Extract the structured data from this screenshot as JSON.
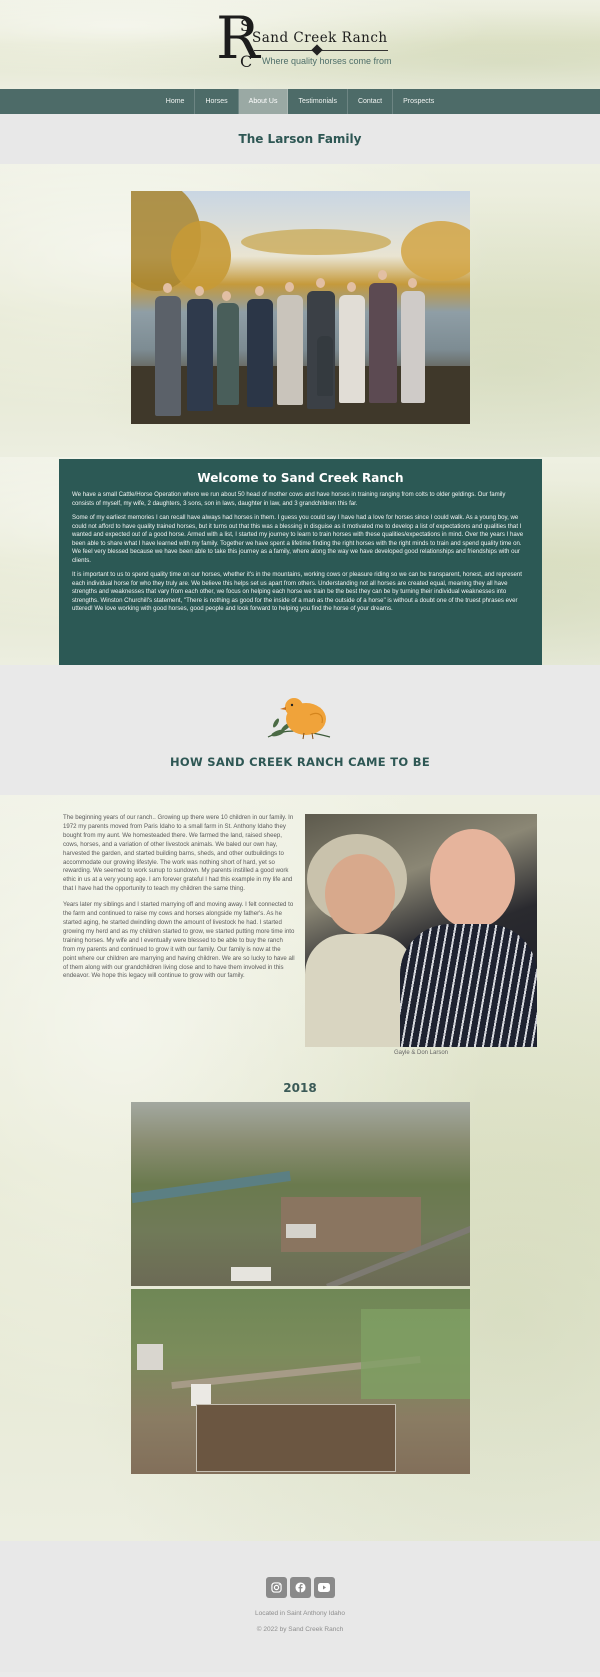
{
  "site": {
    "logo_r": "R",
    "logo_s": "S",
    "logo_c": "C",
    "brand": "Sand Creek Ranch",
    "tagline": "Where quality horses come from"
  },
  "nav": {
    "items": [
      {
        "label": "Home"
      },
      {
        "label": "Horses"
      },
      {
        "label": "About Us",
        "active": true
      },
      {
        "label": "Testimonials"
      },
      {
        "label": "Contact"
      },
      {
        "label": "Prospects"
      }
    ]
  },
  "page_title": "The Larson Family",
  "welcome": {
    "title": "Welcome to Sand Creek Ranch",
    "paragraphs": [
      "We have a small Cattle/Horse Operation where we run about 50 head of mother cows and have horses in training ranging from colts to older geldings. Our family consists of myself, my wife, 2 daughters, 3 sons, son in laws, daughter in law, and 3 grandchildren this far.",
      "Some of my earliest memories I can recall have always had horses in them. I guess you could say I have had a love for horses since I could walk. As a young boy, we could not afford to have quality trained horses, but it turns out that this was a blessing in disguise as it motivated me to develop a list of expectations and qualities that I wanted and expected out of a good horse. Armed with a list, I started my journey to learn to train horses with these qualities/expectations in mind. Over the years I have been able to share what I have learned with my family. Together we have spent a lifetime finding the right horses with the right minds to train and spend quality time on. We feel very blessed because we have been able to take this journey as a family, where along the way we have developed good relationships and friendships with our clients.",
      "It is important to us to spend quality time on our horses, whether it's in the mountains, working cows or pleasure riding so we can be transparent, honest, and represent each individual horse for who they truly are. We believe this helps set us apart from others. Understanding not all horses are created equal, meaning they all have strengths and weaknesses that vary from each other, we focus on helping each horse we train be the best they can be by turning their individual weaknesses into strengths. Winston Churchill's statement, \"There is nothing as good for the inside of a man as the outside of a horse\" is without a doubt one of the truest phrases ever uttered! We love working with good horses, good people and look forward to helping you find the horse of your dreams."
    ]
  },
  "how": {
    "heading": "HOW SAND CREEK RANCH CAME TO BE",
    "paragraphs": [
      "The beginning years of our ranch.. Growing up there were 10 children in our family. In 1972 my parents moved from Paris Idaho to a small farm in St. Anthony Idaho they bought from my aunt. We homesteaded there. We farmed the land, raised sheep, cows, horses, and a variation of other livestock animals. We baled our own hay, harvested the garden, and started building barns, sheds, and other outbuildings to accommodate our growing lifestyle. The work was nothing short of hard, yet so rewarding. We seemed to work sunup to sundown. My parents instilled a good work ethic in us at a very young age. I am forever grateful I had this example in my life and that I have had the opportunity to teach my children the same thing.",
      "Years later my siblings and I started marrying off and moving away. I felt connected to the farm and continued to raise my cows and horses alongside my father's. As he started aging, he started dwindling down the amount of livestock he had. I started growing my herd and as my children started to grow, we started putting more time into training horses. My wife and I eventually were blessed to be able to buy the ranch from my parents and continued to grow it with our family. Our family is now at the point where our children are marrying and having children. We are so lucky to have all of them along with our grandchildren living close and to have them involved in this endeavor. We hope this legacy will continue to grow with our family."
    ],
    "photo_caption": "Gayle & Don Larson",
    "year": "2018"
  },
  "footer": {
    "social": [
      {
        "icon": "instagram-icon"
      },
      {
        "icon": "facebook-icon"
      },
      {
        "icon": "youtube-icon"
      }
    ],
    "located": "Located in Saint Anthony Idaho",
    "copyright": "© 2022 by Sand Creek Ranch"
  },
  "colors": {
    "nav_bg": "#4d6b68",
    "nav_active": "#9aa9a4",
    "welcome_bg": "#2c5955",
    "heading": "#2e5754"
  }
}
